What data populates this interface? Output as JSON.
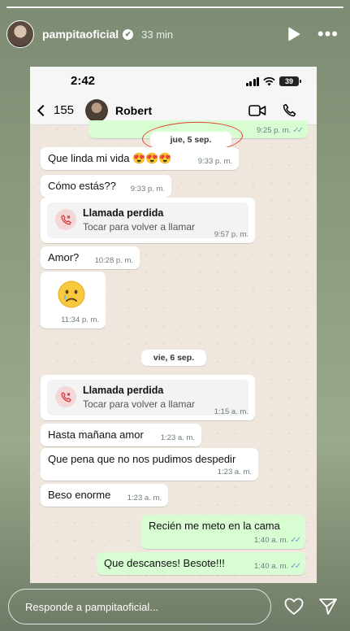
{
  "story": {
    "username": "pampitaoficial",
    "verified_glyph": "✔",
    "time_ago": "33 min",
    "icons": {
      "play": "play-icon",
      "more": "more-icon"
    }
  },
  "phone": {
    "status_time": "2:42",
    "battery": "39",
    "back_count": "155",
    "contact_name": "Robert",
    "top_partial_time": "9:25 p. m."
  },
  "chat": {
    "date1": "jue, 5 sep.",
    "date2": "vie, 6 sep.",
    "messages": [
      {
        "text": "Que linda mi vida 😍😍😍",
        "time": "9:33 p. m."
      },
      {
        "text": "Cómo estás??",
        "time": "9:33 p. m."
      },
      {
        "title": "Llamada perdida",
        "subtitle": "Tocar para volver a llamar",
        "time": "9:57 p. m."
      },
      {
        "text": "Amor?",
        "time": "10:28 p. m."
      },
      {
        "text": "😢",
        "time": "11:34 p. m."
      },
      {
        "title": "Llamada perdida",
        "subtitle": "Tocar para volver a llamar",
        "time": "1:15 a. m."
      },
      {
        "text": "Hasta mañana amor",
        "time": "1:23 a. m."
      },
      {
        "text": "Que pena que no nos pudimos despedir",
        "time": "1:23 a. m."
      },
      {
        "text": "Beso enorme",
        "time": "1:23 a. m."
      },
      {
        "text": "Recién me meto en la cama",
        "time": "1:40 a. m."
      },
      {
        "text": "Que descanses! Besote!!!",
        "time": "1:40 a. m."
      }
    ],
    "tick_glyph": "✓✓",
    "colors": {
      "incoming": "#ffffff",
      "outgoing": "#d9fdd3",
      "annotation": "#e0452e"
    }
  },
  "reply": {
    "placeholder": "Responde a pampitaoficial...",
    "icons": {
      "like": "heart-icon",
      "share": "send-icon"
    }
  }
}
